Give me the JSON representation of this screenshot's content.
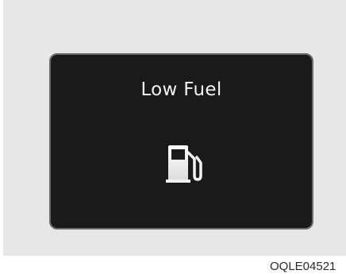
{
  "display": {
    "message": "Low Fuel",
    "icon": "fuel-pump-icon"
  },
  "caption": {
    "code": "OQLE04521"
  },
  "colors": {
    "background": "#e7e7e8",
    "screen": "#1b1a1a",
    "screen_border": "#6c6c6c",
    "text": "#f2f2f2"
  }
}
